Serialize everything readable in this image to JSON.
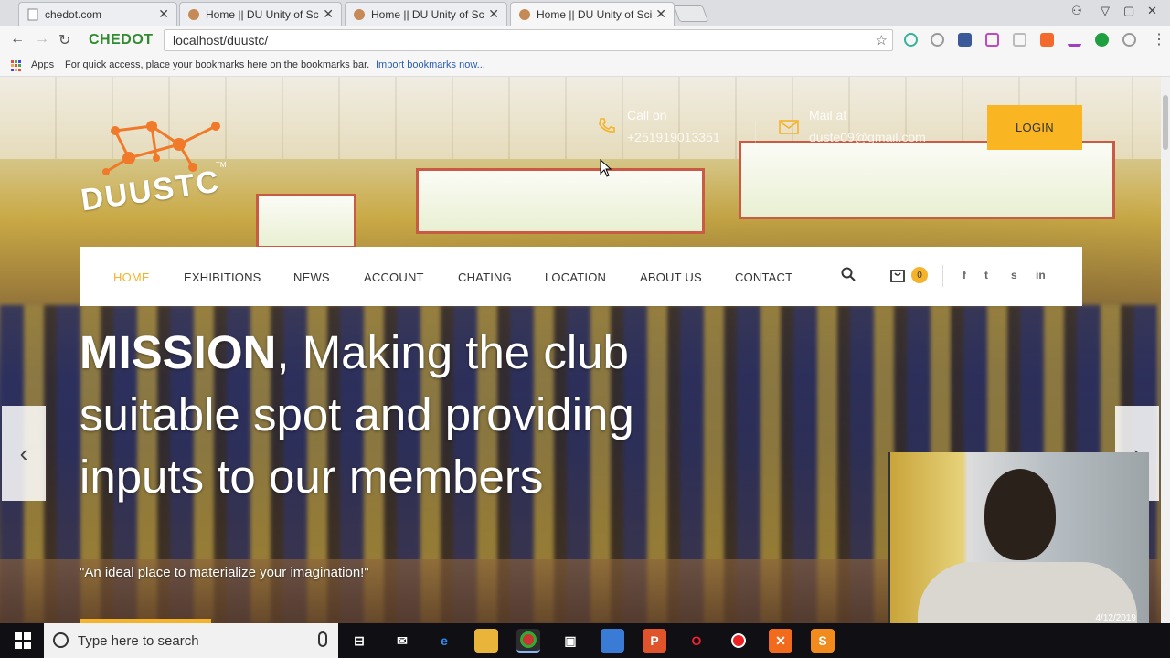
{
  "browser": {
    "tabs": [
      {
        "title": "chedot.com",
        "active": false
      },
      {
        "title": "Home || DU Unity of Scie",
        "active": false
      },
      {
        "title": "Home || DU Unity of Scie",
        "active": false
      },
      {
        "title": "Home || DU Unity of Scie",
        "active": true
      }
    ],
    "brand": "CHEDOT",
    "url": "localhost/duustc/",
    "bookmarks": {
      "apps_label": "Apps",
      "hint": "For quick access, place your bookmarks here on the bookmarks bar.",
      "import_link": "Import bookmarks now..."
    }
  },
  "site": {
    "logo_text": "DUUSTC",
    "logo_tm": "TM",
    "call_label": "Call on",
    "call_value": "+251919013351",
    "mail_label": "Mail at",
    "mail_value": "duste09@gmail.com",
    "login_label": "LOGIN",
    "nav": [
      "HOME",
      "EXHIBITIONS",
      "NEWS",
      "ACCOUNT",
      "CHATING",
      "LOCATION",
      "ABOUT US",
      "CONTACT"
    ],
    "cart_count": "0",
    "social": [
      "f",
      "t",
      "s",
      "in"
    ],
    "headline_bold": "MISSION",
    "headline_rest": ", Making the club suitable spot and providing inputs to our members",
    "tagline": "\"An ideal place to materialize your imagination!\"",
    "arrow_prev": "‹",
    "arrow_next": "›"
  },
  "webcam": {
    "date": "4/12/2019"
  },
  "taskbar": {
    "search_placeholder": "Type here to search"
  },
  "colors": {
    "accent": "#f4b32b",
    "login_bg": "#f9b522",
    "brand_green": "#2e8b2e"
  }
}
